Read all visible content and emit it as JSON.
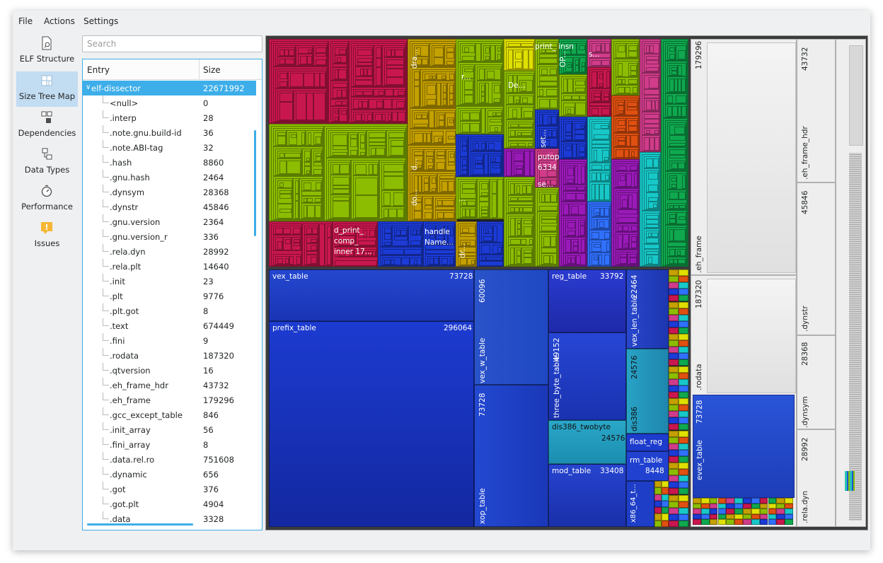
{
  "menu": [
    "File",
    "Actions",
    "Settings"
  ],
  "views": [
    {
      "label": "ELF Structure",
      "icon": "document-search-icon"
    },
    {
      "label": "Size Tree Map",
      "icon": "treemap-icon",
      "active": true
    },
    {
      "label": "Dependencies",
      "icon": "dependencies-icon"
    },
    {
      "label": "Data Types",
      "icon": "data-types-icon"
    },
    {
      "label": "Performance",
      "icon": "stopwatch-icon"
    },
    {
      "label": "Issues",
      "icon": "warning-icon"
    }
  ],
  "search": {
    "placeholder": "Search"
  },
  "tree": {
    "columns": [
      "Entry",
      "Size"
    ],
    "rows": [
      {
        "entry": "elf-dissector",
        "size": "22671992",
        "selected": true
      },
      {
        "entry": "<null>",
        "size": "0"
      },
      {
        "entry": ".interp",
        "size": "28"
      },
      {
        "entry": ".note.gnu.build-id",
        "size": "36"
      },
      {
        "entry": ".note.ABI-tag",
        "size": "32"
      },
      {
        "entry": ".hash",
        "size": "8860"
      },
      {
        "entry": ".gnu.hash",
        "size": "2464"
      },
      {
        "entry": ".dynsym",
        "size": "28368"
      },
      {
        "entry": ".dynstr",
        "size": "45846"
      },
      {
        "entry": ".gnu.version",
        "size": "2364"
      },
      {
        "entry": ".gnu.version_r",
        "size": "336"
      },
      {
        "entry": ".rela.dyn",
        "size": "28992"
      },
      {
        "entry": ".rela.plt",
        "size": "14640"
      },
      {
        "entry": ".init",
        "size": "23"
      },
      {
        "entry": ".plt",
        "size": "9776"
      },
      {
        "entry": ".plt.got",
        "size": "8"
      },
      {
        "entry": ".text",
        "size": "674449"
      },
      {
        "entry": ".fini",
        "size": "9"
      },
      {
        "entry": ".rodata",
        "size": "187320"
      },
      {
        "entry": ".qtversion",
        "size": "16"
      },
      {
        "entry": ".eh_frame_hdr",
        "size": "43732"
      },
      {
        "entry": ".eh_frame",
        "size": "179296"
      },
      {
        "entry": ".gcc_except_table",
        "size": "846"
      },
      {
        "entry": ".init_array",
        "size": "56"
      },
      {
        "entry": ".fini_array",
        "size": "8"
      },
      {
        "entry": ".data.rel.ro",
        "size": "751608"
      },
      {
        "entry": ".dynamic",
        "size": "656"
      },
      {
        "entry": ".got",
        "size": "376"
      },
      {
        "entry": ".got.plt",
        "size": "4904"
      },
      {
        "entry": ".data",
        "size": "3328"
      }
    ]
  },
  "treemap": {
    "text_labels": [
      {
        "label": "dra..."
      },
      {
        "label": "r..."
      },
      {
        "label": "De..."
      },
      {
        "label": "print_ insn"
      },
      {
        "label": "OP..."
      },
      {
        "label": "s..."
      },
      {
        "label": "d..."
      },
      {
        "label": "do..."
      },
      {
        "label": "set..."
      },
      {
        "label": "putop 6334"
      },
      {
        "label": "se..."
      },
      {
        "label": "..."
      },
      {
        "label": "dr..."
      },
      {
        "label": "d_print_ comp_ inner 17..."
      },
      {
        "label": "handle Name..."
      }
    ],
    "data_rel_ro": [
      {
        "name": "vex_table",
        "size": "73728"
      },
      {
        "name": "prefix_table",
        "size": "296064"
      },
      {
        "name": "vex_w_table",
        "size": "60096"
      },
      {
        "name": "xop_table",
        "size": "73728"
      },
      {
        "name": "reg_table",
        "size": "33792"
      },
      {
        "name": "three_byte_table",
        "size": "49152"
      },
      {
        "name": "dis386_twobyte",
        "size": "24576"
      },
      {
        "name": "mod_table",
        "size": "33408"
      },
      {
        "name": "vex_len_table",
        "size": "22464"
      },
      {
        "name": "dis386",
        "size": "24576"
      },
      {
        "name": "float_reg",
        "size": ""
      },
      {
        "name": "rm_table",
        "size": "8448"
      },
      {
        "name": "x86_64_t...",
        "size": ""
      }
    ],
    "sections": [
      {
        "name": ".eh_frame",
        "size": "179296"
      },
      {
        "name": ".rodata",
        "size": "187320"
      },
      {
        "name": "evex_table",
        "size": "73728"
      },
      {
        "name": ".eh_frame_hdr",
        "size": "43732"
      },
      {
        "name": ".dynstr",
        "size": "45846"
      },
      {
        "name": ".dynsym",
        "size": "28368"
      },
      {
        "name": ".rela.dyn",
        "size": "28992"
      }
    ],
    "colors": {
      "text_section_palette": [
        "#c8174e",
        "#8cbd00",
        "#c4a000",
        "#0fa84e",
        "#1c3bd6",
        "#9a1ab8",
        "#e0e000",
        "#d03c8a",
        "#18c8c8",
        "#3070ff",
        "#e05010"
      ],
      "data_section_blue": "#1a3fd0"
    }
  }
}
